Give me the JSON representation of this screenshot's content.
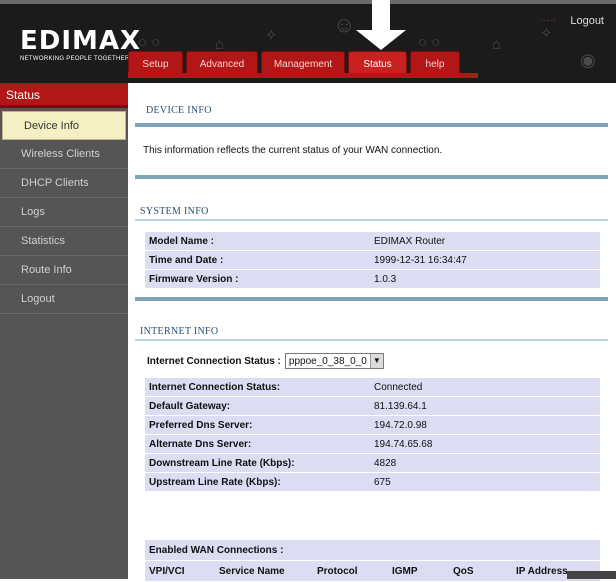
{
  "brand": {
    "logo": "EDIMAX",
    "tagline": "NETWORKING PEOPLE TOGETHER"
  },
  "header": {
    "logout_label": "Logout",
    "deco_text": "·····"
  },
  "tabs": [
    {
      "label": "Setup"
    },
    {
      "label": "Advanced"
    },
    {
      "label": "Management"
    },
    {
      "label": "Status"
    },
    {
      "label": "help"
    }
  ],
  "sidebar": {
    "title": "Status",
    "items": [
      {
        "label": "Device Info"
      },
      {
        "label": "Wireless Clients"
      },
      {
        "label": "DHCP Clients"
      },
      {
        "label": "Logs"
      },
      {
        "label": "Statistics"
      },
      {
        "label": "Route Info"
      },
      {
        "label": "Logout"
      }
    ]
  },
  "main": {
    "device_info_title": "DEVICE INFO",
    "intro": "This information reflects the current status of your WAN connection.",
    "system_info_title": "SYSTEM INFO",
    "system_info": [
      {
        "label": "Model Name :",
        "value": "EDIMAX Router"
      },
      {
        "label": "Time and Date :",
        "value": "1999-12-31 16:34:47"
      },
      {
        "label": "Firmware Version :",
        "value": "1.0.3"
      }
    ],
    "internet_info_title": "INTERNET INFO",
    "connection_status_label": "Internet Connection Status :",
    "connection_select_value": "pppoe_0_38_0_0",
    "internet_info": [
      {
        "label": "Internet Connection Status:",
        "value": "Connected"
      },
      {
        "label": "Default Gateway:",
        "value": "81.139.64.1"
      },
      {
        "label": "Preferred Dns Server:",
        "value": "194.72.0.98"
      },
      {
        "label": "Alternate Dns Server:",
        "value": "194.74.65.68"
      },
      {
        "label": "Downstream Line Rate (Kbps):",
        "value": "4828"
      },
      {
        "label": "Upstream Line Rate (Kbps):",
        "value": "675"
      }
    ],
    "wan_title": "Enabled WAN Connections :",
    "wan_headers": [
      "VPI/VCI",
      "Service Name",
      "Protocol",
      "IGMP",
      "QoS",
      "IP Address"
    ]
  },
  "colors": {
    "accent": "#b31616",
    "sidebar": "#555555",
    "table_row": "#dcdcf2",
    "section_title": "#2d4f70"
  }
}
